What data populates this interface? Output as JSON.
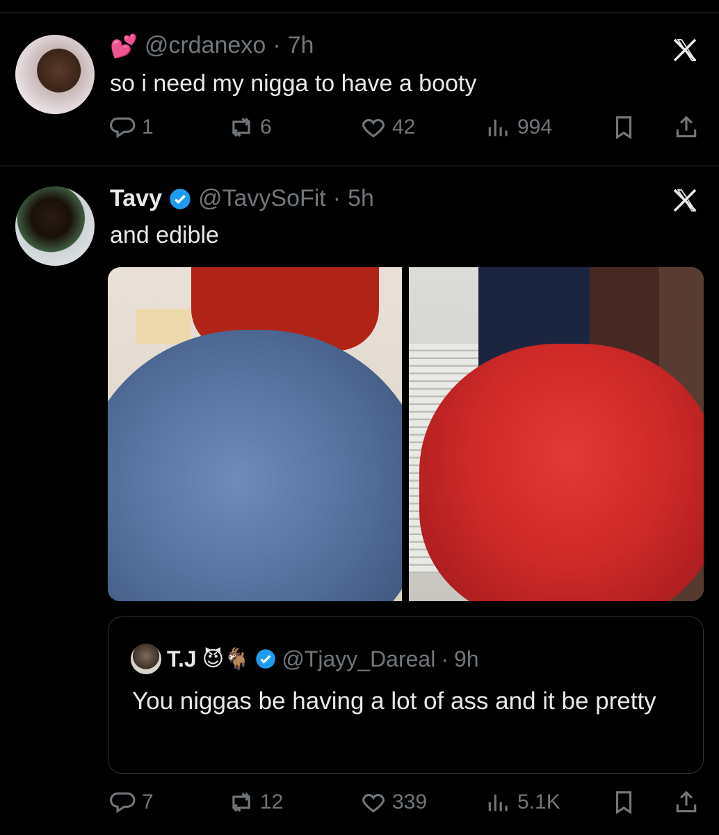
{
  "tweet1": {
    "emoji": "💕",
    "handle": "@crdanexo",
    "time": "7h",
    "text": "so i need my nigga to have a booty",
    "stats": {
      "replies": "1",
      "reposts": "6",
      "likes": "42",
      "views": "994"
    }
  },
  "tweet2": {
    "name": "Tavy",
    "handle": "@TavySoFit",
    "time": "5h",
    "text": "and edible",
    "stats": {
      "replies": "7",
      "reposts": "12",
      "likes": "339",
      "views": "5.1K"
    }
  },
  "quote": {
    "name": "T.J",
    "emojis": "😈🐐",
    "handle": "@Tjayy_Dareal",
    "time": "9h",
    "text": "You niggas be having a lot of ass and it be pretty"
  },
  "colors": {
    "background": "#000000",
    "text": "#e7e9ea",
    "muted": "#71767b",
    "verified": "#1d9bf0",
    "divider": "#2f3336"
  },
  "icons": [
    "x-logo-icon",
    "reply-icon",
    "repost-icon",
    "like-icon",
    "views-icon",
    "bookmark-icon",
    "share-icon",
    "verified-badge-icon"
  ]
}
